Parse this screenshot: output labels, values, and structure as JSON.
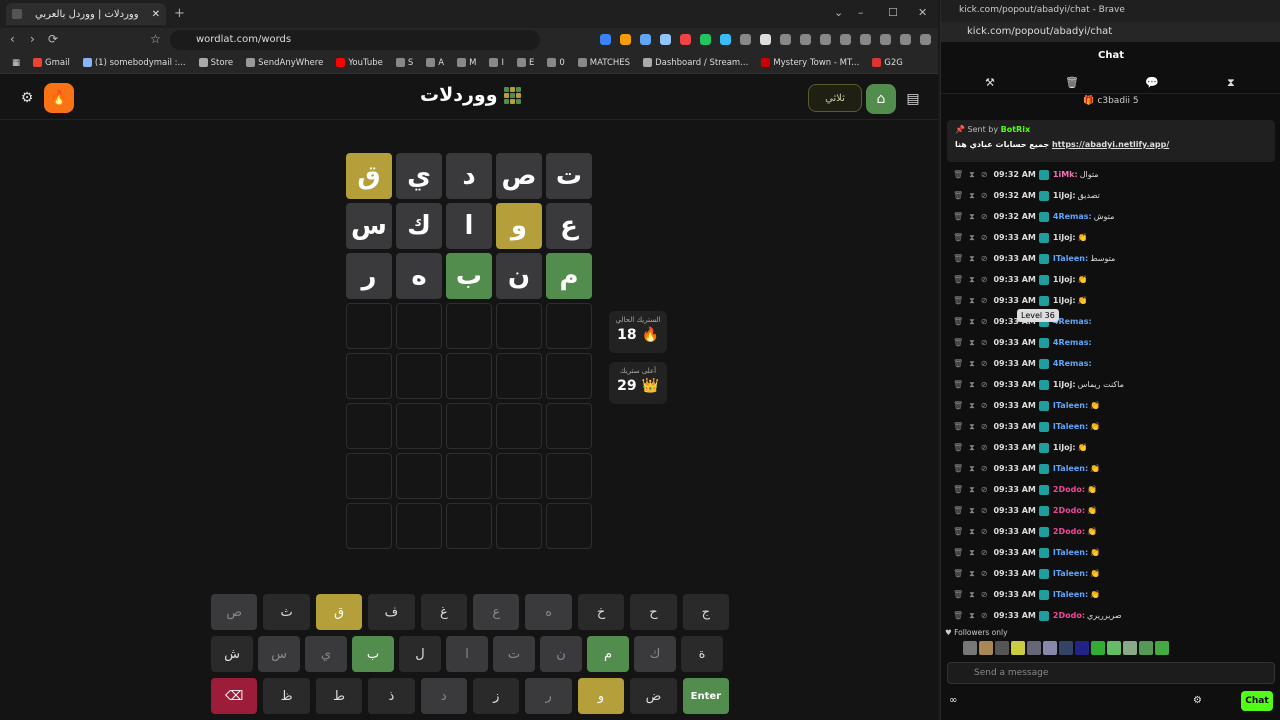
{
  "browser": {
    "tab_title": "ووردلات | ووردل بالعربي",
    "new_tab": "+",
    "url": "wordlat.com/words",
    "window_controls": [
      "⌄",
      "–",
      "☐",
      "✕"
    ],
    "bookmarks": [
      "Gmail",
      "(1) somebodymail :...",
      "Store",
      "SendAnyWhere",
      "YouTube",
      "S",
      "A",
      "M",
      "I",
      "E",
      "0",
      "MATCHES",
      "Dashboard / Stream...",
      "Mystery Town - MT...",
      "G2G"
    ],
    "bookmark_colors": [
      "#ea4335",
      "#8ab4f8",
      "#aaa",
      "#999",
      "#ff0000",
      "#888",
      "#888",
      "#888",
      "#888",
      "#888",
      "#888",
      "#888",
      "#aaa",
      "#c00",
      "#d33"
    ],
    "extension_colors": [
      "#3b82f6",
      "#f59e0b",
      "#60a5fa",
      "#93c5fd",
      "#ef4444",
      "#22c55e",
      "#38bdf8",
      "#888",
      "#ddd",
      "#888",
      "#888",
      "#888",
      "#888",
      "#888",
      "#888",
      "#888",
      "#888"
    ]
  },
  "game": {
    "logo": "ووردلات",
    "mode_label": "ثلاثي",
    "settings_icon": "gear-icon",
    "streak_icon": "fire-icon",
    "home_icon": "home-icon",
    "stats_icon": "chart-icon",
    "logo_dots": [
      "#538d4e",
      "#b59f3b",
      "#538d4e",
      "#b59f3b",
      "#538d4e",
      "#b59f3b",
      "#538d4e",
      "#b59f3b",
      "#538d4e"
    ],
    "colors": {
      "green": "#538d4e",
      "yellow": "#b59f3b",
      "gray": "#3a3a3c",
      "accent": "#f97316"
    },
    "board": [
      [
        {
          "l": "ت",
          "s": "gray"
        },
        {
          "l": "ص",
          "s": "gray"
        },
        {
          "l": "د",
          "s": "gray"
        },
        {
          "l": "ي",
          "s": "gray"
        },
        {
          "l": "ق",
          "s": "yellow"
        }
      ],
      [
        {
          "l": "ع",
          "s": "gray"
        },
        {
          "l": "و",
          "s": "yellow"
        },
        {
          "l": "ا",
          "s": "gray"
        },
        {
          "l": "ك",
          "s": "gray"
        },
        {
          "l": "س",
          "s": "gray"
        }
      ],
      [
        {
          "l": "م",
          "s": "green"
        },
        {
          "l": "ن",
          "s": "gray"
        },
        {
          "l": "ب",
          "s": "green"
        },
        {
          "l": "ه",
          "s": "gray"
        },
        {
          "l": "ر",
          "s": "gray"
        }
      ],
      [
        {
          "l": "",
          "s": "empty"
        },
        {
          "l": "",
          "s": "empty"
        },
        {
          "l": "",
          "s": "empty"
        },
        {
          "l": "",
          "s": "empty"
        },
        {
          "l": "",
          "s": "empty"
        }
      ],
      [
        {
          "l": "",
          "s": "empty"
        },
        {
          "l": "",
          "s": "empty"
        },
        {
          "l": "",
          "s": "empty"
        },
        {
          "l": "",
          "s": "empty"
        },
        {
          "l": "",
          "s": "empty"
        }
      ],
      [
        {
          "l": "",
          "s": "empty"
        },
        {
          "l": "",
          "s": "empty"
        },
        {
          "l": "",
          "s": "empty"
        },
        {
          "l": "",
          "s": "empty"
        },
        {
          "l": "",
          "s": "empty"
        }
      ],
      [
        {
          "l": "",
          "s": "empty"
        },
        {
          "l": "",
          "s": "empty"
        },
        {
          "l": "",
          "s": "empty"
        },
        {
          "l": "",
          "s": "empty"
        },
        {
          "l": "",
          "s": "empty"
        }
      ],
      [
        {
          "l": "",
          "s": "empty"
        },
        {
          "l": "",
          "s": "empty"
        },
        {
          "l": "",
          "s": "empty"
        },
        {
          "l": "",
          "s": "empty"
        },
        {
          "l": "",
          "s": "empty"
        }
      ]
    ],
    "current_streak_label": "الستريك الحالي",
    "current_streak_value": "18",
    "best_streak_label": "أعلى ستريك",
    "best_streak_value": "29",
    "keyboard": [
      [
        {
          "k": "ج",
          "s": ""
        },
        {
          "k": "ح",
          "s": ""
        },
        {
          "k": "خ",
          "s": ""
        },
        {
          "k": "ه",
          "s": "gray"
        },
        {
          "k": "ع",
          "s": "gray"
        },
        {
          "k": "غ",
          "s": ""
        },
        {
          "k": "ف",
          "s": ""
        },
        {
          "k": "ق",
          "s": "yellow"
        },
        {
          "k": "ث",
          "s": ""
        },
        {
          "k": "ص",
          "s": "gray"
        }
      ],
      [
        {
          "k": "ة",
          "s": ""
        },
        {
          "k": "ك",
          "s": "gray"
        },
        {
          "k": "م",
          "s": "green"
        },
        {
          "k": "ن",
          "s": "gray"
        },
        {
          "k": "ت",
          "s": "gray"
        },
        {
          "k": "ا",
          "s": "gray"
        },
        {
          "k": "ل",
          "s": ""
        },
        {
          "k": "ب",
          "s": "green"
        },
        {
          "k": "ي",
          "s": "gray"
        },
        {
          "k": "س",
          "s": "gray"
        },
        {
          "k": "ش",
          "s": ""
        }
      ],
      [
        {
          "k": "Enter",
          "s": "enter"
        },
        {
          "k": "ض",
          "s": ""
        },
        {
          "k": "و",
          "s": "yellow"
        },
        {
          "k": "ر",
          "s": "gray"
        },
        {
          "k": "ز",
          "s": ""
        },
        {
          "k": "د",
          "s": "gray"
        },
        {
          "k": "ذ",
          "s": ""
        },
        {
          "k": "ط",
          "s": ""
        },
        {
          "k": "ظ",
          "s": ""
        },
        {
          "k": "⌫",
          "s": "red"
        }
      ]
    ]
  },
  "chat": {
    "window_title": "kick.com/popout/abadyi/chat - Brave",
    "url": "kick.com/popout/abadyi/chat",
    "header": "Chat",
    "top_user": "c3badii",
    "top_user_count": "5",
    "pinned": {
      "sent_by": "Sent by",
      "bot": "BotRix",
      "text": "جميع حسابات عبادي هنا",
      "link": "https://abadyi.netlify.app/"
    },
    "tooltip": "Level 36",
    "messages": [
      {
        "t": "09:32 AM",
        "u": "1iMk:",
        "c": "#f472b6",
        "m": "متوال"
      },
      {
        "t": "09:32 AM",
        "u": "1iJoj:",
        "c": "#ddd",
        "m": "تصديق"
      },
      {
        "t": "09:32 AM",
        "u": "4Remas:",
        "c": "#60a5fa",
        "m": "متوش"
      },
      {
        "t": "09:33 AM",
        "u": "1iJoj:",
        "c": "#ddd",
        "m": "👏"
      },
      {
        "t": "09:33 AM",
        "u": "ITaleen:",
        "c": "#60a5fa",
        "m": "متوسط"
      },
      {
        "t": "09:33 AM",
        "u": "1iJoj:",
        "c": "#ddd",
        "m": "👏"
      },
      {
        "t": "09:33 AM",
        "u": "1iJoj:",
        "c": "#ddd",
        "m": "👏"
      },
      {
        "t": "09:33 AM",
        "u": "4Remas:",
        "c": "#60a5fa",
        "m": ""
      },
      {
        "t": "09:33 AM",
        "u": "4Remas:",
        "c": "#60a5fa",
        "m": ""
      },
      {
        "t": "09:33 AM",
        "u": "4Remas:",
        "c": "#60a5fa",
        "m": ""
      },
      {
        "t": "09:33 AM",
        "u": "1iJoj:",
        "c": "#ddd",
        "m": "ماكنت ريماس"
      },
      {
        "t": "09:33 AM",
        "u": "ITaleen:",
        "c": "#60a5fa",
        "m": "👏"
      },
      {
        "t": "09:33 AM",
        "u": "ITaleen:",
        "c": "#60a5fa",
        "m": "👏"
      },
      {
        "t": "09:33 AM",
        "u": "1iJoj:",
        "c": "#ddd",
        "m": "👏"
      },
      {
        "t": "09:33 AM",
        "u": "ITaleen:",
        "c": "#60a5fa",
        "m": "👏"
      },
      {
        "t": "09:33 AM",
        "u": "2Dodo:",
        "c": "#ec4899",
        "m": "👏"
      },
      {
        "t": "09:33 AM",
        "u": "2Dodo:",
        "c": "#ec4899",
        "m": "👏"
      },
      {
        "t": "09:33 AM",
        "u": "2Dodo:",
        "c": "#ec4899",
        "m": "👏"
      },
      {
        "t": "09:33 AM",
        "u": "ITaleen:",
        "c": "#60a5fa",
        "m": "👏"
      },
      {
        "t": "09:33 AM",
        "u": "ITaleen:",
        "c": "#60a5fa",
        "m": "👏"
      },
      {
        "t": "09:33 AM",
        "u": "ITaleen:",
        "c": "#60a5fa",
        "m": "👏"
      },
      {
        "t": "09:33 AM",
        "u": "2Dodo:",
        "c": "#ec4899",
        "m": "صريرريري"
      }
    ],
    "followers_only": "Followers only",
    "follower_avatar_colors": [
      "#777",
      "#a85",
      "#555",
      "#cc4",
      "#667",
      "#88a",
      "#346",
      "#228",
      "#3a3",
      "#6b6",
      "#8a8",
      "#595",
      "#4a4"
    ],
    "send_placeholder": "Send a message",
    "chat_button": "Chat"
  }
}
